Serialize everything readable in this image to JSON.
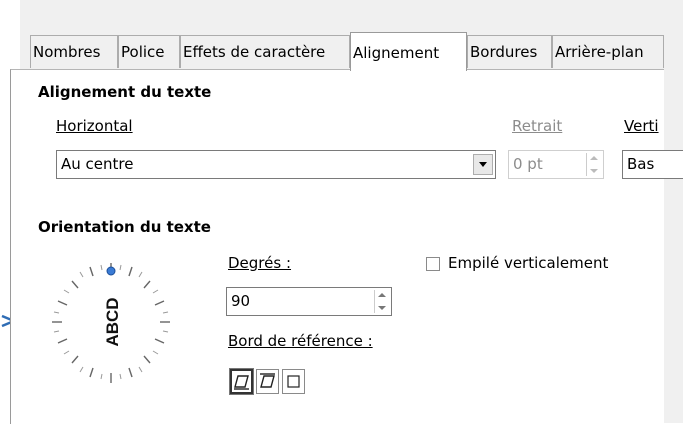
{
  "tabs": [
    "Nombres",
    "Police",
    "Effets de caractère",
    "Alignement",
    "Bordures",
    "Arrière-plan"
  ],
  "active_tab": "Alignement",
  "text_alignment": {
    "heading": "Alignement du texte",
    "horizontal_label": "Horizontal",
    "horizontal_value": "Au centre",
    "indent_label": "Retrait",
    "indent_value": "0 pt",
    "vertical_label": "Verti",
    "vertical_value": "Bas"
  },
  "text_orientation": {
    "heading": "Orientation du texte",
    "dial_text": "ABCD",
    "degrees_label": "Degrés :",
    "degrees_value": "90",
    "stacked_label": "Empilé verticalement",
    "stacked_checked": false,
    "reference_edge_label": "Bord de référence :",
    "reference_edge_selected": 0
  }
}
